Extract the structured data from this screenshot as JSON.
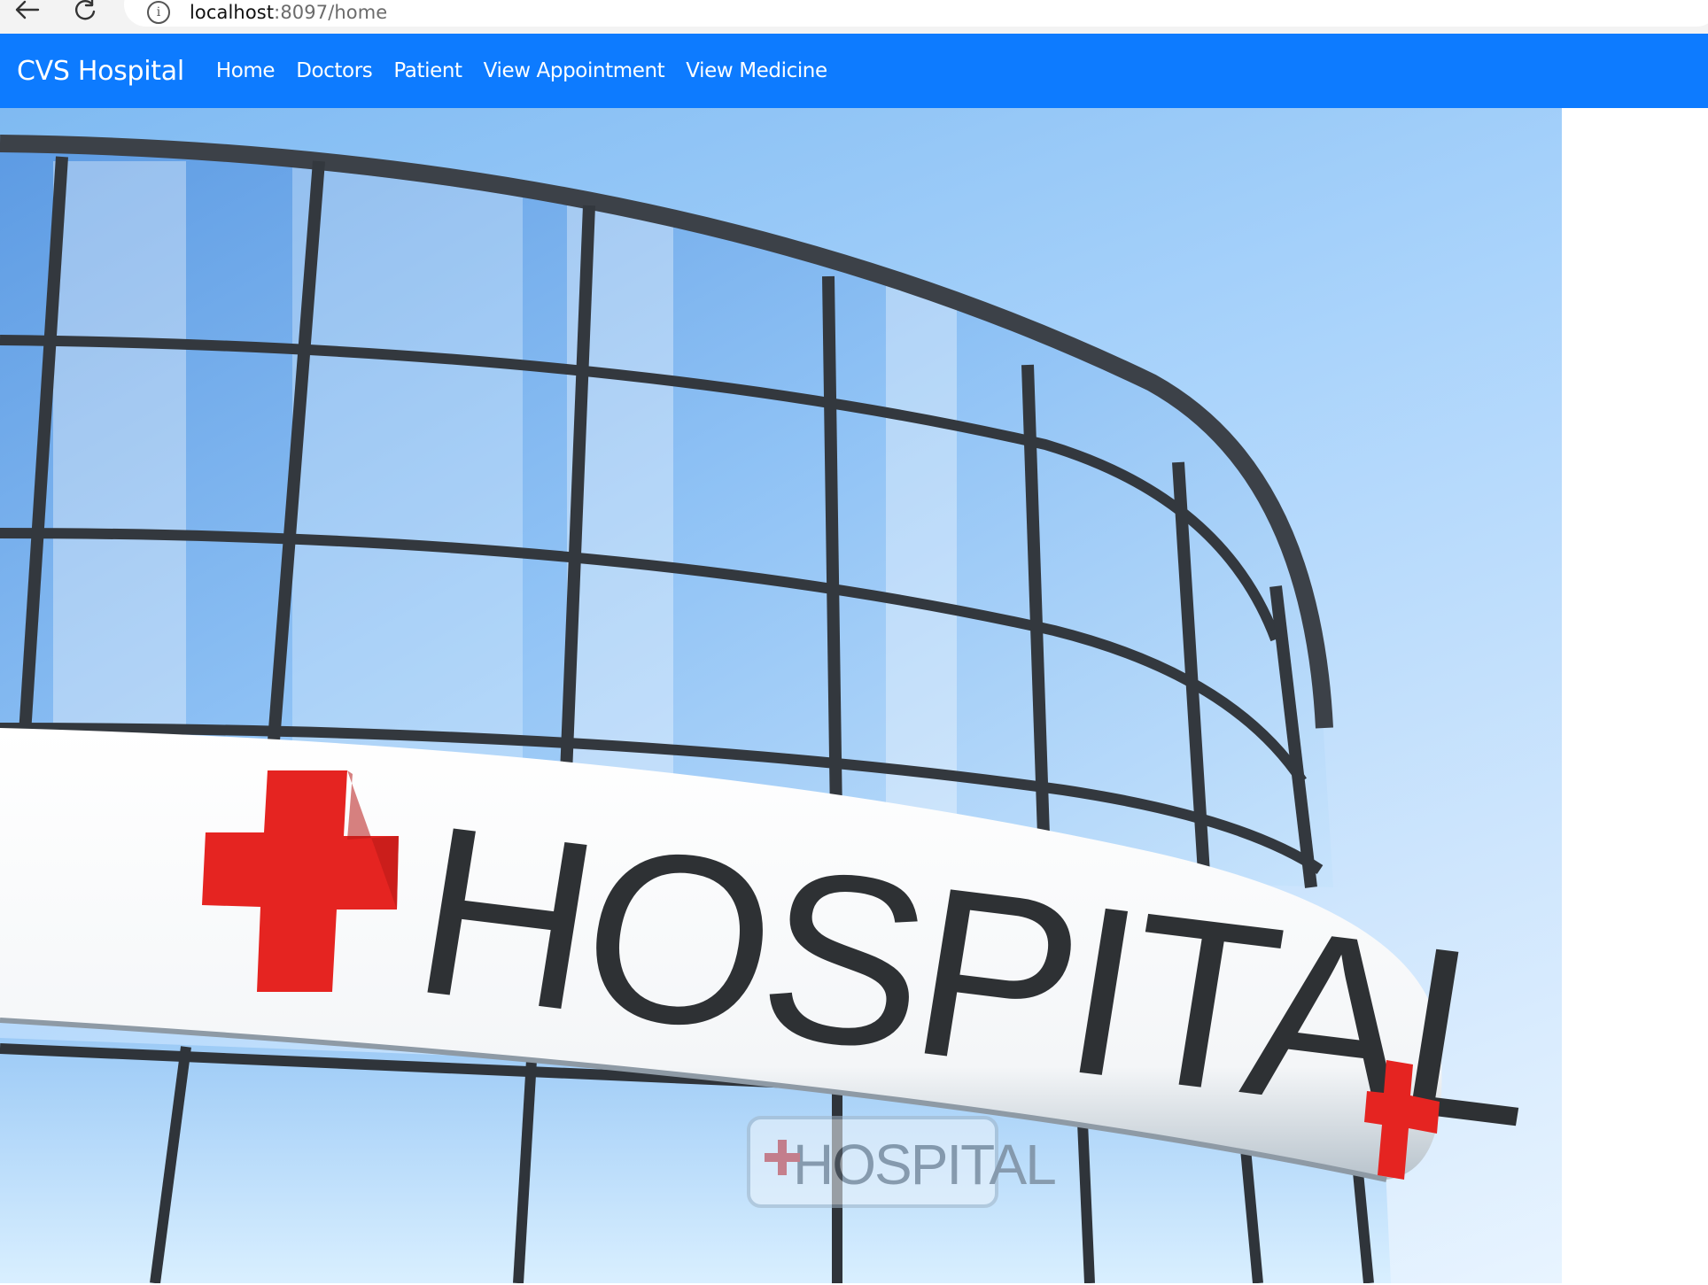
{
  "browser": {
    "url_host": "localhost",
    "url_rest": ":8097/home"
  },
  "navbar": {
    "brand": "CVS Hospital",
    "links": [
      {
        "label": "Home"
      },
      {
        "label": "Doctors"
      },
      {
        "label": "Patient"
      },
      {
        "label": "View Appointment"
      },
      {
        "label": "View Medicine"
      }
    ]
  },
  "hero": {
    "sign_text": "HOSPITAL",
    "reflection_text": "HOSPITAL"
  },
  "colors": {
    "navbar_bg": "#0d7bff",
    "cross_red": "#e52421",
    "sky": "#a9d3fb"
  }
}
